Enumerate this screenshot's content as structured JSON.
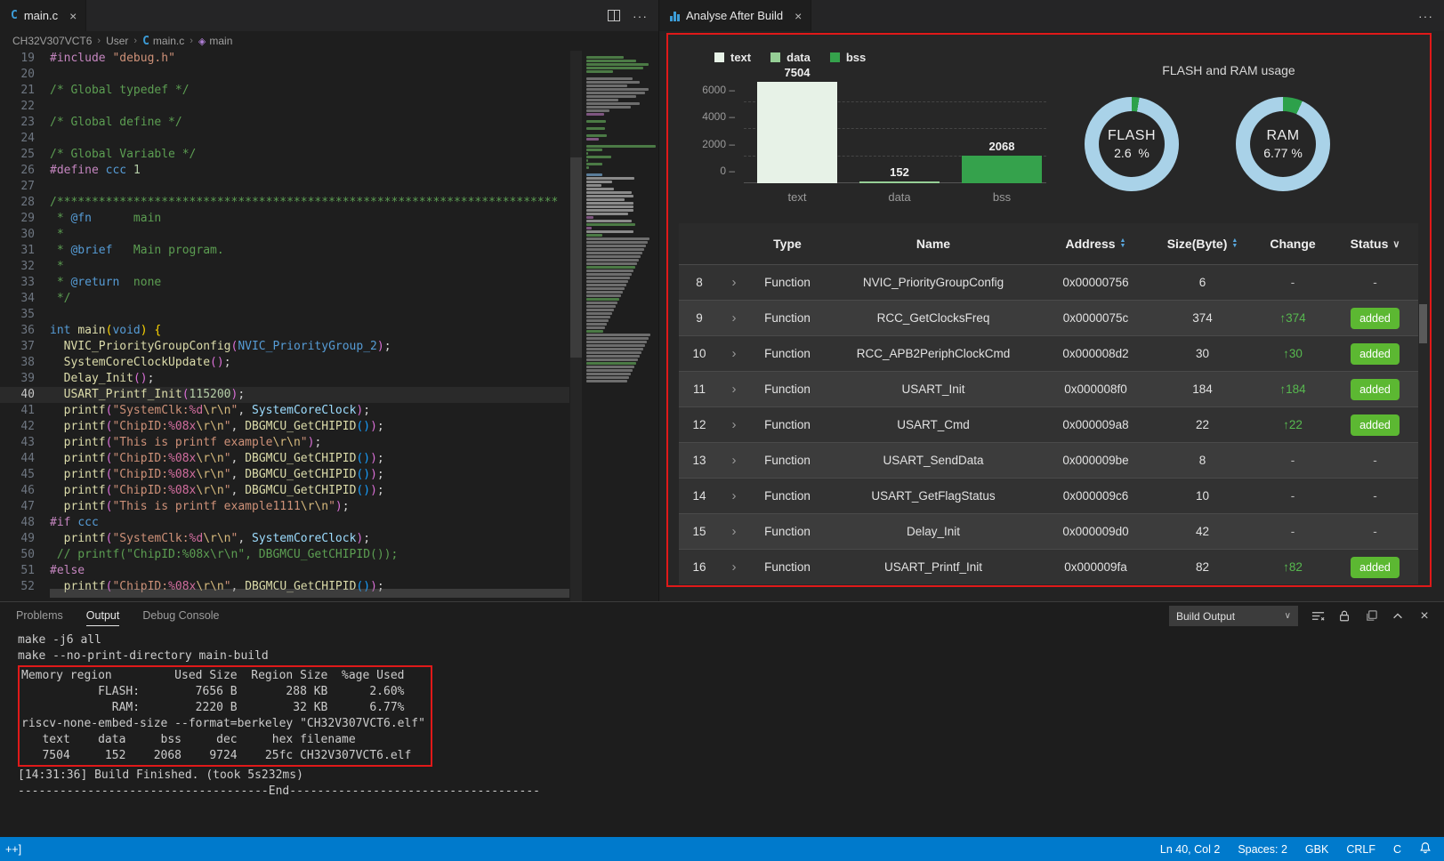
{
  "left_group": {
    "tab": {
      "label": "main.c",
      "icon": "C"
    },
    "breadcrumb": {
      "items": [
        "CH32V307VCT6",
        "User",
        "main.c",
        "main"
      ]
    },
    "editor": {
      "current_line": 40,
      "lines": [
        {
          "n": 19,
          "t": [
            [
              "pp",
              "#include "
            ],
            [
              "str",
              "\"debug.h\""
            ]
          ]
        },
        {
          "n": 20,
          "t": []
        },
        {
          "n": 21,
          "t": [
            [
              "cmt",
              "/* Global typedef */"
            ]
          ]
        },
        {
          "n": 22,
          "t": []
        },
        {
          "n": 23,
          "t": [
            [
              "cmt",
              "/* Global define */"
            ]
          ]
        },
        {
          "n": 24,
          "t": []
        },
        {
          "n": 25,
          "t": [
            [
              "cmt",
              "/* Global Variable */"
            ]
          ]
        },
        {
          "n": 26,
          "t": [
            [
              "pp",
              "#define "
            ],
            [
              "ident",
              "ccc "
            ],
            [
              "num",
              "1"
            ]
          ]
        },
        {
          "n": 27,
          "t": []
        },
        {
          "n": 28,
          "t": [
            [
              "cmt",
              "/************************************************************************"
            ]
          ]
        },
        {
          "n": 29,
          "t": [
            [
              "cmt",
              " * "
            ],
            [
              "dockw",
              "@fn"
            ],
            [
              "cmt",
              "      main"
            ]
          ]
        },
        {
          "n": 30,
          "t": [
            [
              "cmt",
              " *"
            ]
          ]
        },
        {
          "n": 31,
          "t": [
            [
              "cmt",
              " * "
            ],
            [
              "dockw",
              "@brief"
            ],
            [
              "cmt",
              "   Main program."
            ]
          ]
        },
        {
          "n": 32,
          "t": [
            [
              "cmt",
              " *"
            ]
          ]
        },
        {
          "n": 33,
          "t": [
            [
              "cmt",
              " * "
            ],
            [
              "dockw",
              "@return"
            ],
            [
              "cmt",
              "  none"
            ]
          ]
        },
        {
          "n": 34,
          "t": [
            [
              "cmt",
              " */"
            ]
          ]
        },
        {
          "n": 35,
          "t": []
        },
        {
          "n": 36,
          "t": [
            [
              "kw",
              "int "
            ],
            [
              "fn",
              "main"
            ],
            [
              "p1",
              "("
            ],
            [
              "kw",
              "void"
            ],
            [
              "p1",
              ")"
            ],
            [
              "plain",
              " "
            ],
            [
              "p1",
              "{"
            ]
          ]
        },
        {
          "n": 37,
          "t": [
            [
              "plain",
              "  "
            ],
            [
              "fn",
              "NVIC_PriorityGroupConfig"
            ],
            [
              "p2",
              "("
            ],
            [
              "ident",
              "NVIC_PriorityGroup_2"
            ],
            [
              "p2",
              ")"
            ],
            [
              "plain",
              ";"
            ]
          ]
        },
        {
          "n": 38,
          "t": [
            [
              "plain",
              "  "
            ],
            [
              "fn",
              "SystemCoreClockUpdate"
            ],
            [
              "p2",
              "()"
            ],
            [
              "plain",
              ";"
            ]
          ]
        },
        {
          "n": 39,
          "t": [
            [
              "plain",
              "  "
            ],
            [
              "fn",
              "Delay_Init"
            ],
            [
              "p2",
              "()"
            ],
            [
              "plain",
              ";"
            ]
          ]
        },
        {
          "n": 40,
          "t": [
            [
              "plain",
              "  "
            ],
            [
              "fn",
              "USART_Printf_Init"
            ],
            [
              "p2",
              "("
            ],
            [
              "num",
              "115200"
            ],
            [
              "p2",
              ")"
            ],
            [
              "plain",
              ";"
            ]
          ]
        },
        {
          "n": 41,
          "t": [
            [
              "plain",
              "  "
            ],
            [
              "fn",
              "printf"
            ],
            [
              "p2",
              "("
            ],
            [
              "str",
              "\"SystemClk:"
            ],
            [
              "fmt",
              "%d"
            ],
            [
              "esc",
              "\\r\\n"
            ],
            [
              "str",
              "\""
            ],
            [
              "plain",
              ", "
            ],
            [
              "var",
              "SystemCoreClock"
            ],
            [
              "p2",
              ")"
            ],
            [
              "plain",
              ";"
            ]
          ]
        },
        {
          "n": 42,
          "t": [
            [
              "plain",
              "  "
            ],
            [
              "fn",
              "printf"
            ],
            [
              "p2",
              "("
            ],
            [
              "str",
              "\"ChipID:"
            ],
            [
              "fmt",
              "%08x"
            ],
            [
              "esc",
              "\\r\\n"
            ],
            [
              "str",
              "\""
            ],
            [
              "plain",
              ", "
            ],
            [
              "fn",
              "DBGMCU_GetCHIPID"
            ],
            [
              "p3",
              "()"
            ],
            [
              "p2",
              ")"
            ],
            [
              "plain",
              ";"
            ]
          ]
        },
        {
          "n": 43,
          "t": [
            [
              "plain",
              "  "
            ],
            [
              "fn",
              "printf"
            ],
            [
              "p2",
              "("
            ],
            [
              "str",
              "\"This is printf example"
            ],
            [
              "esc",
              "\\r\\n"
            ],
            [
              "str",
              "\""
            ],
            [
              "p2",
              ")"
            ],
            [
              "plain",
              ";"
            ]
          ]
        },
        {
          "n": 44,
          "t": [
            [
              "plain",
              "  "
            ],
            [
              "fn",
              "printf"
            ],
            [
              "p2",
              "("
            ],
            [
              "str",
              "\"ChipID:"
            ],
            [
              "fmt",
              "%08x"
            ],
            [
              "esc",
              "\\r\\n"
            ],
            [
              "str",
              "\""
            ],
            [
              "plain",
              ", "
            ],
            [
              "fn",
              "DBGMCU_GetCHIPID"
            ],
            [
              "p3",
              "()"
            ],
            [
              "p2",
              ")"
            ],
            [
              "plain",
              ";"
            ]
          ]
        },
        {
          "n": 45,
          "t": [
            [
              "plain",
              "  "
            ],
            [
              "fn",
              "printf"
            ],
            [
              "p2",
              "("
            ],
            [
              "str",
              "\"ChipID:"
            ],
            [
              "fmt",
              "%08x"
            ],
            [
              "esc",
              "\\r\\n"
            ],
            [
              "str",
              "\""
            ],
            [
              "plain",
              ", "
            ],
            [
              "fn",
              "DBGMCU_GetCHIPID"
            ],
            [
              "p3",
              "()"
            ],
            [
              "p2",
              ")"
            ],
            [
              "plain",
              ";"
            ]
          ]
        },
        {
          "n": 46,
          "t": [
            [
              "plain",
              "  "
            ],
            [
              "fn",
              "printf"
            ],
            [
              "p2",
              "("
            ],
            [
              "str",
              "\"ChipID:"
            ],
            [
              "fmt",
              "%08x"
            ],
            [
              "esc",
              "\\r\\n"
            ],
            [
              "str",
              "\""
            ],
            [
              "plain",
              ", "
            ],
            [
              "fn",
              "DBGMCU_GetCHIPID"
            ],
            [
              "p3",
              "()"
            ],
            [
              "p2",
              ")"
            ],
            [
              "plain",
              ";"
            ]
          ]
        },
        {
          "n": 47,
          "t": [
            [
              "plain",
              "  "
            ],
            [
              "fn",
              "printf"
            ],
            [
              "p2",
              "("
            ],
            [
              "str",
              "\"This is printf example1111"
            ],
            [
              "esc",
              "\\r\\n"
            ],
            [
              "str",
              "\""
            ],
            [
              "p2",
              ")"
            ],
            [
              "plain",
              ";"
            ]
          ]
        },
        {
          "n": 48,
          "t": [
            [
              "pp",
              "#if "
            ],
            [
              "ident",
              "ccc"
            ]
          ]
        },
        {
          "n": 49,
          "t": [
            [
              "plain",
              "  "
            ],
            [
              "fn",
              "printf"
            ],
            [
              "p2",
              "("
            ],
            [
              "str",
              "\"SystemClk:"
            ],
            [
              "fmt",
              "%d"
            ],
            [
              "esc",
              "\\r\\n"
            ],
            [
              "str",
              "\""
            ],
            [
              "plain",
              ", "
            ],
            [
              "var",
              "SystemCoreClock"
            ],
            [
              "p2",
              ")"
            ],
            [
              "plain",
              ";"
            ]
          ]
        },
        {
          "n": 50,
          "t": [
            [
              "cmt",
              " // printf(\"ChipID:%08x\\r\\n\", DBGMCU_GetCHIPID());"
            ]
          ]
        },
        {
          "n": 51,
          "t": [
            [
              "pp",
              "#else"
            ]
          ]
        },
        {
          "n": 52,
          "t": [
            [
              "plain",
              "  "
            ],
            [
              "fn",
              "printf"
            ],
            [
              "p2",
              "("
            ],
            [
              "str",
              "\"ChipID:"
            ],
            [
              "fmt",
              "%08x"
            ],
            [
              "esc",
              "\\r\\n"
            ],
            [
              "str",
              "\""
            ],
            [
              "plain",
              ", "
            ],
            [
              "fn",
              "DBGMCU_GetCHIPID"
            ],
            [
              "p3",
              "()"
            ],
            [
              "p2",
              ")"
            ],
            [
              "plain",
              ";"
            ]
          ]
        }
      ]
    }
  },
  "right_group": {
    "tab": {
      "label": "Analyse After Build"
    }
  },
  "chart_data": [
    {
      "type": "bar",
      "categories": [
        "text",
        "data",
        "bss"
      ],
      "values": [
        7504,
        152,
        2068
      ],
      "bar_colors": [
        "#e7f2e7",
        "#96cf96",
        "#35a24c"
      ],
      "legend": [
        "text",
        "data",
        "bss"
      ],
      "legend_position": "top-left",
      "yticks": [
        0,
        2000,
        4000,
        6000
      ],
      "ylim": [
        0,
        7600
      ],
      "grid": "horizontal-dashed",
      "title": "",
      "xlabel": "",
      "ylabel": ""
    },
    {
      "type": "donut",
      "title": "FLASH and RAM usage",
      "ring_color": "#a9d2e8",
      "used_color": "#2da14b",
      "series": [
        {
          "name": "FLASH",
          "percent": 2.6,
          "value_display": "2.6  %"
        },
        {
          "name": "RAM",
          "percent": 6.77,
          "value_display": "6.77 %"
        }
      ]
    }
  ],
  "table": {
    "headers": [
      {
        "label": "Type",
        "sort": "none"
      },
      {
        "label": "Name",
        "sort": "none"
      },
      {
        "label": "Address",
        "sort": "updown"
      },
      {
        "label": "Size(Byte)",
        "sort": "updown"
      },
      {
        "label": "Change",
        "sort": "none"
      },
      {
        "label": "Status",
        "sort": "chevron"
      }
    ],
    "rows": [
      {
        "index": 8,
        "type": "Function",
        "name": "NVIC_PriorityGroupConfig",
        "address": "0x00000756",
        "size": "6",
        "change": "-",
        "status": "-"
      },
      {
        "index": 9,
        "type": "Function",
        "name": "RCC_GetClocksFreq",
        "address": "0x0000075c",
        "size": "374",
        "change": "↑374",
        "status": "added"
      },
      {
        "index": 10,
        "type": "Function",
        "name": "RCC_APB2PeriphClockCmd",
        "address": "0x000008d2",
        "size": "30",
        "change": "↑30",
        "status": "added"
      },
      {
        "index": 11,
        "type": "Function",
        "name": "USART_Init",
        "address": "0x000008f0",
        "size": "184",
        "change": "↑184",
        "status": "added"
      },
      {
        "index": 12,
        "type": "Function",
        "name": "USART_Cmd",
        "address": "0x000009a8",
        "size": "22",
        "change": "↑22",
        "status": "added"
      },
      {
        "index": 13,
        "type": "Function",
        "name": "USART_SendData",
        "address": "0x000009be",
        "size": "8",
        "change": "-",
        "status": "-"
      },
      {
        "index": 14,
        "type": "Function",
        "name": "USART_GetFlagStatus",
        "address": "0x000009c6",
        "size": "10",
        "change": "-",
        "status": "-"
      },
      {
        "index": 15,
        "type": "Function",
        "name": "Delay_Init",
        "address": "0x000009d0",
        "size": "42",
        "change": "-",
        "status": "-"
      },
      {
        "index": 16,
        "type": "Function",
        "name": "USART_Printf_Init",
        "address": "0x000009fa",
        "size": "82",
        "change": "↑82",
        "status": "added"
      }
    ]
  },
  "bottom_panel": {
    "tabs": [
      "Problems",
      "Output",
      "Debug Console"
    ],
    "active_tab": "Output",
    "dropdown": "Build Output",
    "lines_before": [
      "make -j6 all",
      "make --no-print-directory main-build"
    ],
    "boxed_lines": [
      "Memory region         Used Size  Region Size  %age Used",
      "           FLASH:        7656 B       288 KB      2.60%",
      "             RAM:        2220 B        32 KB      6.77%",
      "riscv-none-embed-size --format=berkeley \"CH32V307VCT6.elf\"",
      "   text    data     bss     dec     hex filename",
      "   7504     152    2068    9724    25fc CH32V307VCT6.elf"
    ],
    "lines_after": [
      "[14:31:36] Build Finished. (took 5s232ms)",
      "------------------------------------End------------------------------------"
    ]
  },
  "status_bar": {
    "left": "++]",
    "items": [
      "Ln 40, Col 2",
      "Spaces: 2",
      "GBK",
      "CRLF",
      "C"
    ]
  },
  "colors": {
    "annotation_red": "#e01919",
    "badge_green": "#5cb832",
    "change_green": "#57b94f",
    "status_blue": "#007acc"
  }
}
